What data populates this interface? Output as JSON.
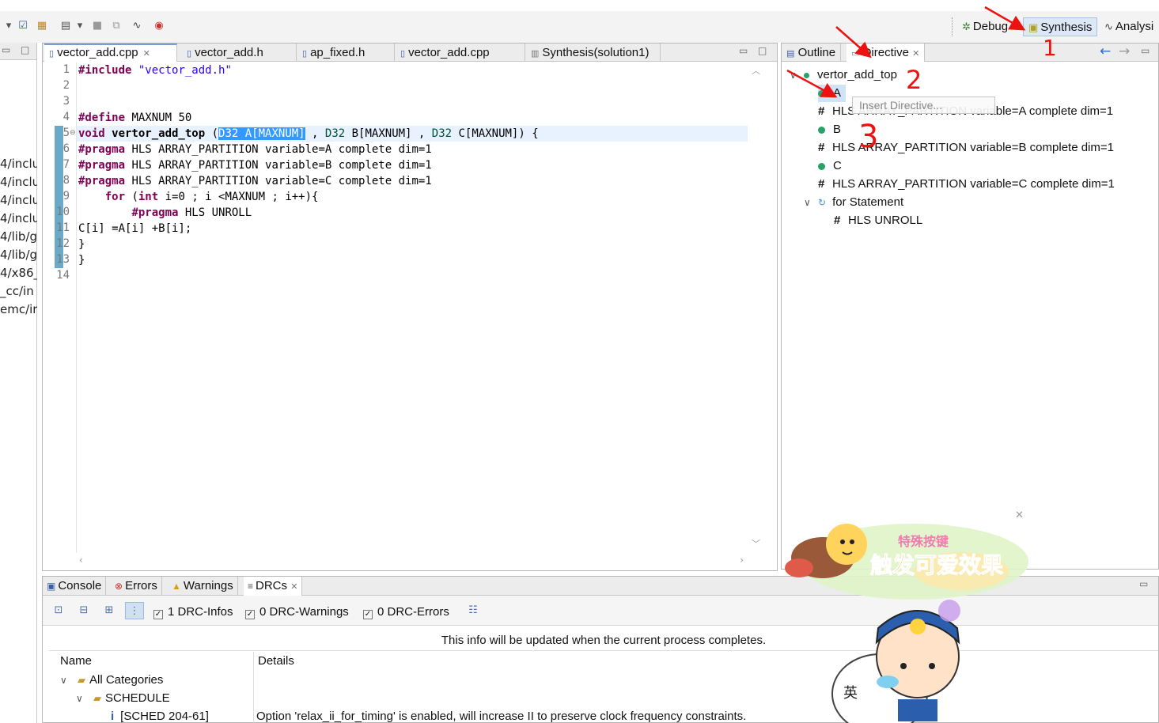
{
  "perspectives": {
    "debug": "Debug",
    "synthesis": "Synthesis",
    "analysis": "Analysi"
  },
  "left_panel": {
    "items": [
      "4/inclu",
      "4/inclu",
      "4/inclu",
      "4/inclu",
      "4/lib/g",
      "4/lib/g",
      "4/x86_",
      "_cc/in",
      "emc/ir"
    ]
  },
  "editor": {
    "tabs": [
      "vector_add.cpp",
      "vector_add.h",
      "ap_fixed.h",
      "vector_add.cpp",
      "Synthesis(solution1)"
    ],
    "line_numbers": [
      "1",
      "2",
      "3",
      "4",
      "5",
      "6",
      "7",
      "8",
      "9",
      "10",
      "11",
      "12",
      "13",
      "14"
    ],
    "code": {
      "l1_kw": "#include",
      "l1_str": "\"vector_add.h\"",
      "l4_kw": "#define",
      "l4_rest": " MAXNUM 50",
      "l5_kw": "void",
      "l5_fn": " vertor_add_top ",
      "l5_paren": "(",
      "l5_sel": "D32 A[MAXNUM]",
      "l5_rest1": " , ",
      "l5_ty2": "D32",
      "l5_rest2": " B[MAXNUM] , ",
      "l5_ty3": "D32",
      "l5_rest3": " C[MAXNUM]) {",
      "l6_kw": "#pragma",
      "l6_rest": " HLS ARRAY_PARTITION variable=A complete dim=1",
      "l7_kw": "#pragma",
      "l7_rest": " HLS ARRAY_PARTITION variable=B complete dim=1",
      "l8_kw": "#pragma",
      "l8_rest": " HLS ARRAY_PARTITION variable=C complete dim=1",
      "l9_indent": "    ",
      "l9_kw": "for",
      "l9_rest1": " (",
      "l9_kw2": "int",
      "l9_rest2": " i=0 ; i <MAXNUM ; i++){",
      "l10_indent": "        ",
      "l10_kw": "#pragma",
      "l10_rest": " HLS UNROLL",
      "l11": "C[i] =A[i] +B[i];",
      "l12": "}",
      "l13": "}"
    }
  },
  "directive_panel": {
    "tabs": {
      "outline": "Outline",
      "directive": "Directive"
    },
    "tree": {
      "root": "vertor_add_top",
      "items": [
        {
          "label": "A",
          "type": "variable"
        },
        {
          "label": "HLS ARRAY_PARTITION variable=A complete dim=1",
          "type": "directive"
        },
        {
          "label": "B",
          "type": "variable"
        },
        {
          "label": "HLS ARRAY_PARTITION variable=B complete dim=1",
          "type": "directive"
        },
        {
          "label": "C",
          "type": "variable"
        },
        {
          "label": "HLS ARRAY_PARTITION variable=C complete dim=1",
          "type": "directive"
        },
        {
          "label": "for Statement",
          "type": "loop"
        },
        {
          "label": "HLS UNROLL",
          "type": "directive"
        }
      ]
    },
    "tooltip": "Insert Directive..."
  },
  "bottom_panel": {
    "tabs": [
      "Console",
      "Errors",
      "Warnings",
      "DRCs"
    ],
    "filters": {
      "infos": "1 DRC-Infos",
      "warnings": "0 DRC-Warnings",
      "errors": "0 DRC-Errors"
    },
    "info_message": "This info will be updated when the current process completes.",
    "table": {
      "headers": [
        "Name",
        "Details"
      ],
      "rows": [
        {
          "name": "All Categories",
          "details": ""
        },
        {
          "name": "SCHEDULE",
          "details": ""
        },
        {
          "name": "[SCHED 204-61]",
          "details": "Option 'relax_ii_for_timing' is enabled, will increase II to preserve clock frequency constraints."
        }
      ]
    }
  },
  "annotations": {
    "marks": [
      "1",
      "2",
      "3"
    ],
    "color": "#ee1111"
  },
  "stickers": {
    "banner_text_top": "特殊按键",
    "banner_text_main": "触发可爱效果",
    "ime_char": "英"
  },
  "colors": {
    "keyword": "#7f0055",
    "string": "#2a00ff",
    "selection": "#3399ff",
    "tree_dot": "#27a36a",
    "annotation": "#ee1111"
  }
}
